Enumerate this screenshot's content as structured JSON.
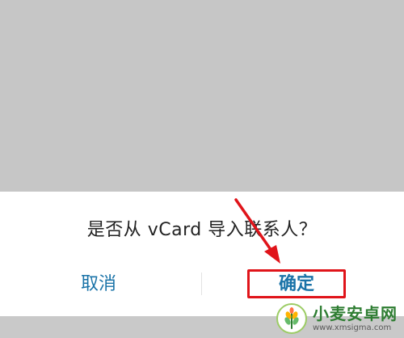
{
  "dialog": {
    "message": "是否从 vCard 导入联系人？",
    "cancel_label": "取消",
    "confirm_label": "确定"
  },
  "annotation": {
    "color": "#e0141a",
    "arrow_icon": "red-arrow-icon",
    "highlight_target": "confirm-button"
  },
  "watermark": {
    "title": "小麦安卓网",
    "url": "www.xmsigma.com",
    "logo_icon": "wheat-logo-icon"
  },
  "colors": {
    "scrim": "#c6c6c6",
    "dialog_bg": "#ffffff",
    "button_text": "#1a73a8",
    "message_text": "#222222"
  }
}
